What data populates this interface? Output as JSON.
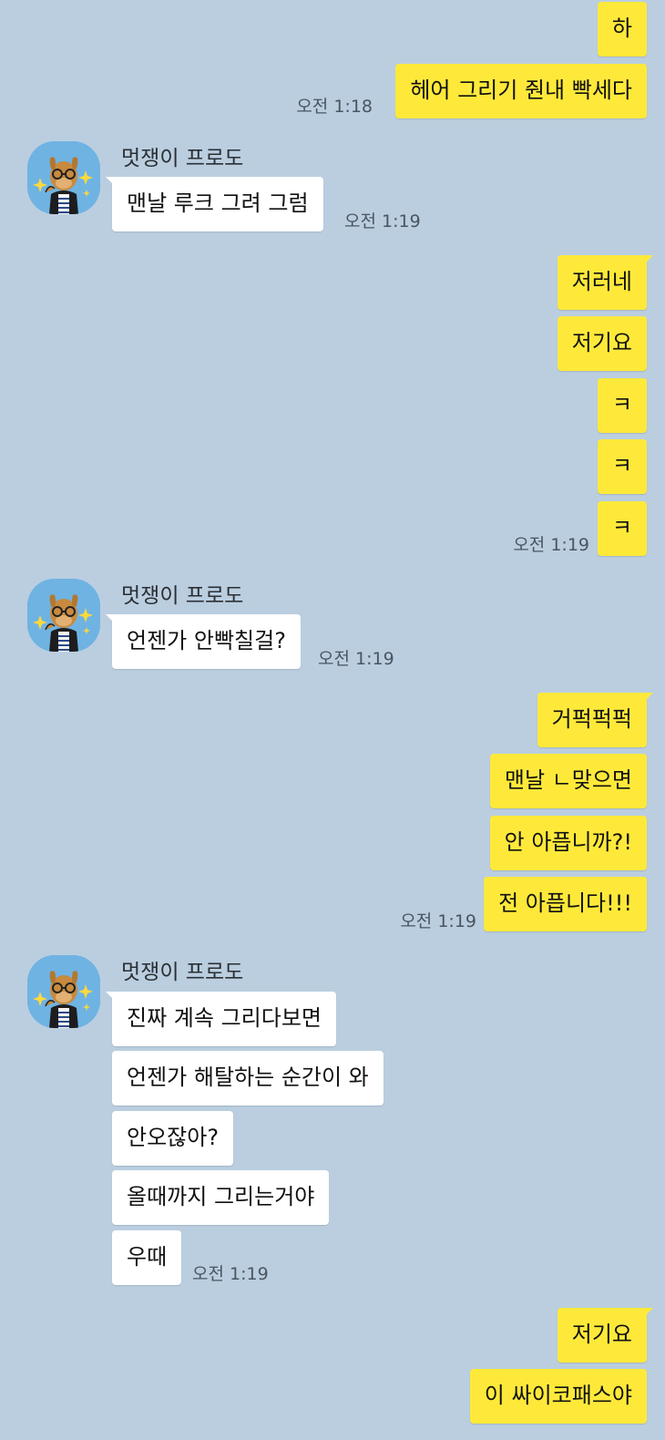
{
  "contact_name": "멋쟁이 프로도",
  "colors": {
    "background": "#bacee0",
    "my_bubble": "#fee93a",
    "their_bubble": "#ffffff"
  },
  "avatar_icon": "frodo-character-icon",
  "messages": [
    {
      "sender": "me",
      "text": "하"
    },
    {
      "sender": "me",
      "text": "헤어 그리기 줜내 빡세다",
      "time": "오전 1:18"
    },
    {
      "sender": "other",
      "text": "맨날 루크 그려 그럼",
      "time": "오전 1:19"
    },
    {
      "sender": "me",
      "text": "저러네"
    },
    {
      "sender": "me",
      "text": "저기요"
    },
    {
      "sender": "me",
      "text": "ㅋ"
    },
    {
      "sender": "me",
      "text": "ㅋ"
    },
    {
      "sender": "me",
      "text": "ㅋ",
      "time": "오전 1:19"
    },
    {
      "sender": "other",
      "text": "언젠가 안빡칠걸?",
      "time": "오전 1:19"
    },
    {
      "sender": "me",
      "text": "거퍽퍽퍽"
    },
    {
      "sender": "me",
      "text": "맨날 ㄴ맞으면"
    },
    {
      "sender": "me",
      "text": "안 아픕니까?!"
    },
    {
      "sender": "me",
      "text": "전 아픕니다!!!",
      "time": "오전 1:19"
    },
    {
      "sender": "other",
      "text": "진짜 계속 그리다보면"
    },
    {
      "sender": "other",
      "text": "언젠가 해탈하는 순간이 와"
    },
    {
      "sender": "other",
      "text": "안오잖아?"
    },
    {
      "sender": "other",
      "text": "올때까지 그리는거야"
    },
    {
      "sender": "other",
      "text": "우때",
      "time": "오전 1:19"
    },
    {
      "sender": "me",
      "text": "저기요"
    },
    {
      "sender": "me",
      "text": "이 싸이코패스야"
    }
  ]
}
